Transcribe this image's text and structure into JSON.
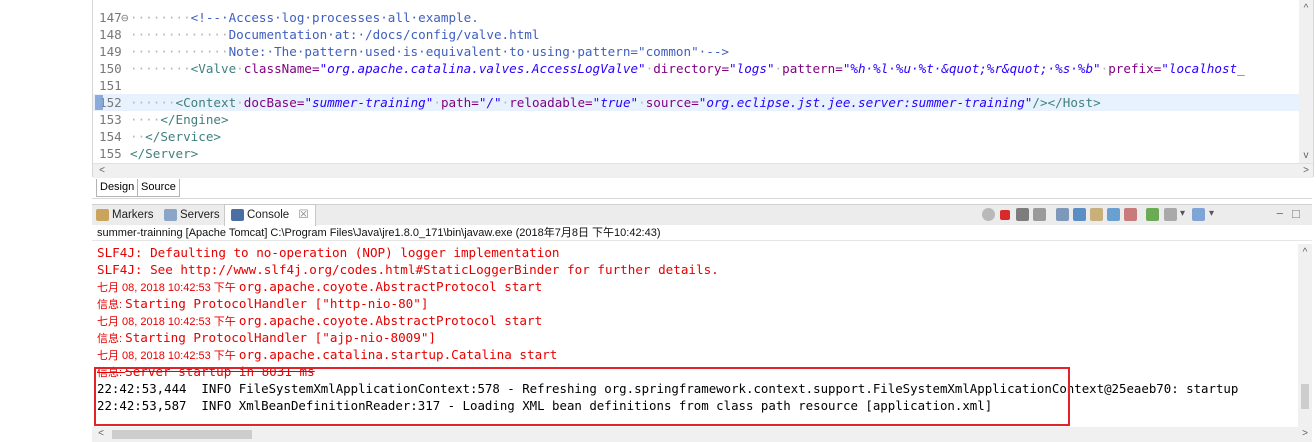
{
  "editor": {
    "lines": [
      {
        "num": "147",
        "fold": "⊖",
        "ws": "········",
        "segs": [
          {
            "c": "cm",
            "t": "<!--·Access·log·processes·all·example."
          }
        ]
      },
      {
        "num": "148",
        "fold": "",
        "ws": "·············",
        "segs": [
          {
            "c": "cm",
            "t": "Documentation·at:·/docs/config/valve.html"
          }
        ]
      },
      {
        "num": "149",
        "fold": "",
        "ws": "·············",
        "segs": [
          {
            "c": "cm",
            "t": "Note:·The·pattern·used·is·equivalent·to·using·pattern=\"common\"·-->"
          }
        ]
      },
      {
        "num": "150",
        "fold": "",
        "ws": "········",
        "segs": [
          {
            "c": "tg",
            "t": "<Valve"
          },
          {
            "c": "ws",
            "t": "·"
          },
          {
            "c": "at",
            "t": "className="
          },
          {
            "c": "av",
            "t": "\"org.apache.catalina.valves.AccessLogValve\""
          },
          {
            "c": "ws",
            "t": "·"
          },
          {
            "c": "at",
            "t": "directory="
          },
          {
            "c": "av",
            "t": "\"logs\""
          },
          {
            "c": "ws",
            "t": "·"
          },
          {
            "c": "at",
            "t": "pattern="
          },
          {
            "c": "av",
            "t": "\"%h·%l·%u·%t·&quot;%r&quot;·%s·%b\""
          },
          {
            "c": "ws",
            "t": "·"
          },
          {
            "c": "at",
            "t": "prefix="
          },
          {
            "c": "av",
            "t": "\"localhost_"
          }
        ]
      },
      {
        "num": "151",
        "fold": "",
        "ws": "",
        "segs": []
      },
      {
        "num": "152",
        "fold": "",
        "ws": "······",
        "segs": [
          {
            "c": "tg",
            "t": "<Context"
          },
          {
            "c": "ws",
            "t": "·"
          },
          {
            "c": "at",
            "t": "docBase="
          },
          {
            "c": "av",
            "t": "\"summer-training\""
          },
          {
            "c": "ws",
            "t": "·"
          },
          {
            "c": "at",
            "t": "path="
          },
          {
            "c": "av",
            "t": "\"/\""
          },
          {
            "c": "ws",
            "t": "·"
          },
          {
            "c": "at",
            "t": "reloadable="
          },
          {
            "c": "av",
            "t": "\"true\""
          },
          {
            "c": "ws",
            "t": "·"
          },
          {
            "c": "at",
            "t": "source="
          },
          {
            "c": "av",
            "t": "\"org.eclipse.jst.jee.server:summer-training\""
          },
          {
            "c": "tg",
            "t": "/></Host>"
          }
        ]
      },
      {
        "num": "153",
        "fold": "",
        "ws": "····",
        "segs": [
          {
            "c": "tg",
            "t": "</Engine>"
          }
        ]
      },
      {
        "num": "154",
        "fold": "",
        "ws": "··",
        "segs": [
          {
            "c": "tg",
            "t": "</Service>"
          }
        ]
      },
      {
        "num": "155",
        "fold": "",
        "ws": "",
        "segs": [
          {
            "c": "tg",
            "t": "</Server>"
          }
        ]
      }
    ],
    "scroll_left": "<",
    "scroll_right": ">",
    "scroll_up": "^",
    "scroll_down": "v"
  },
  "editor_tabs": {
    "design": "Design",
    "source": "Source"
  },
  "views": {
    "markers": "Markers",
    "servers": "Servers",
    "console": "Console",
    "console_close": "☒",
    "toolbar_extra": "▾",
    "minimize": "−",
    "maximize": "□"
  },
  "console": {
    "description": "summer-trainning [Apache Tomcat] C:\\Program Files\\Java\\jre1.8.0_171\\bin\\javaw.exe (2018年7月8日 下午10:42:43)",
    "lines": [
      {
        "k": "err",
        "t": "SLF4J: Defaulting to no-operation (NOP) logger implementation"
      },
      {
        "k": "err",
        "t": "SLF4J: See http://www.slf4j.org/codes.html#StaticLoggerBinder for further details."
      },
      {
        "k": "mix",
        "p": "七月 08, 2018 10:42:53 下午 ",
        "t": "org.apache.coyote.AbstractProtocol start"
      },
      {
        "k": "mix",
        "p": "信息: ",
        "t": "Starting ProtocolHandler [\"http-nio-80\"]"
      },
      {
        "k": "mix",
        "p": "七月 08, 2018 10:42:53 下午 ",
        "t": "org.apache.coyote.AbstractProtocol start"
      },
      {
        "k": "mix",
        "p": "信息: ",
        "t": "Starting ProtocolHandler [\"ajp-nio-8009\"]"
      },
      {
        "k": "mix",
        "p": "七月 08, 2018 10:42:53 下午 ",
        "t": "org.apache.catalina.startup.Catalina start"
      },
      {
        "k": "strike",
        "p": "信息: ",
        "t": "Server startup in 8031 ms"
      },
      {
        "k": "norm",
        "t": "22:42:53,444  INFO FileSystemXmlApplicationContext:578 - Refreshing org.springframework.context.support.FileSystemXmlApplicationContext@25eaeb70: startup"
      },
      {
        "k": "norm",
        "t": "22:42:53,587  INFO XmlBeanDefinitionReader:317 - Loading XML bean definitions from class path resource [application.xml]"
      }
    ],
    "scroll_left": "<",
    "scroll_right": ">",
    "scroll_up": "^"
  },
  "colors": {
    "error": "#e60000",
    "highlight_box": "#e2232a",
    "line_highlight": "#e8f2fe"
  }
}
